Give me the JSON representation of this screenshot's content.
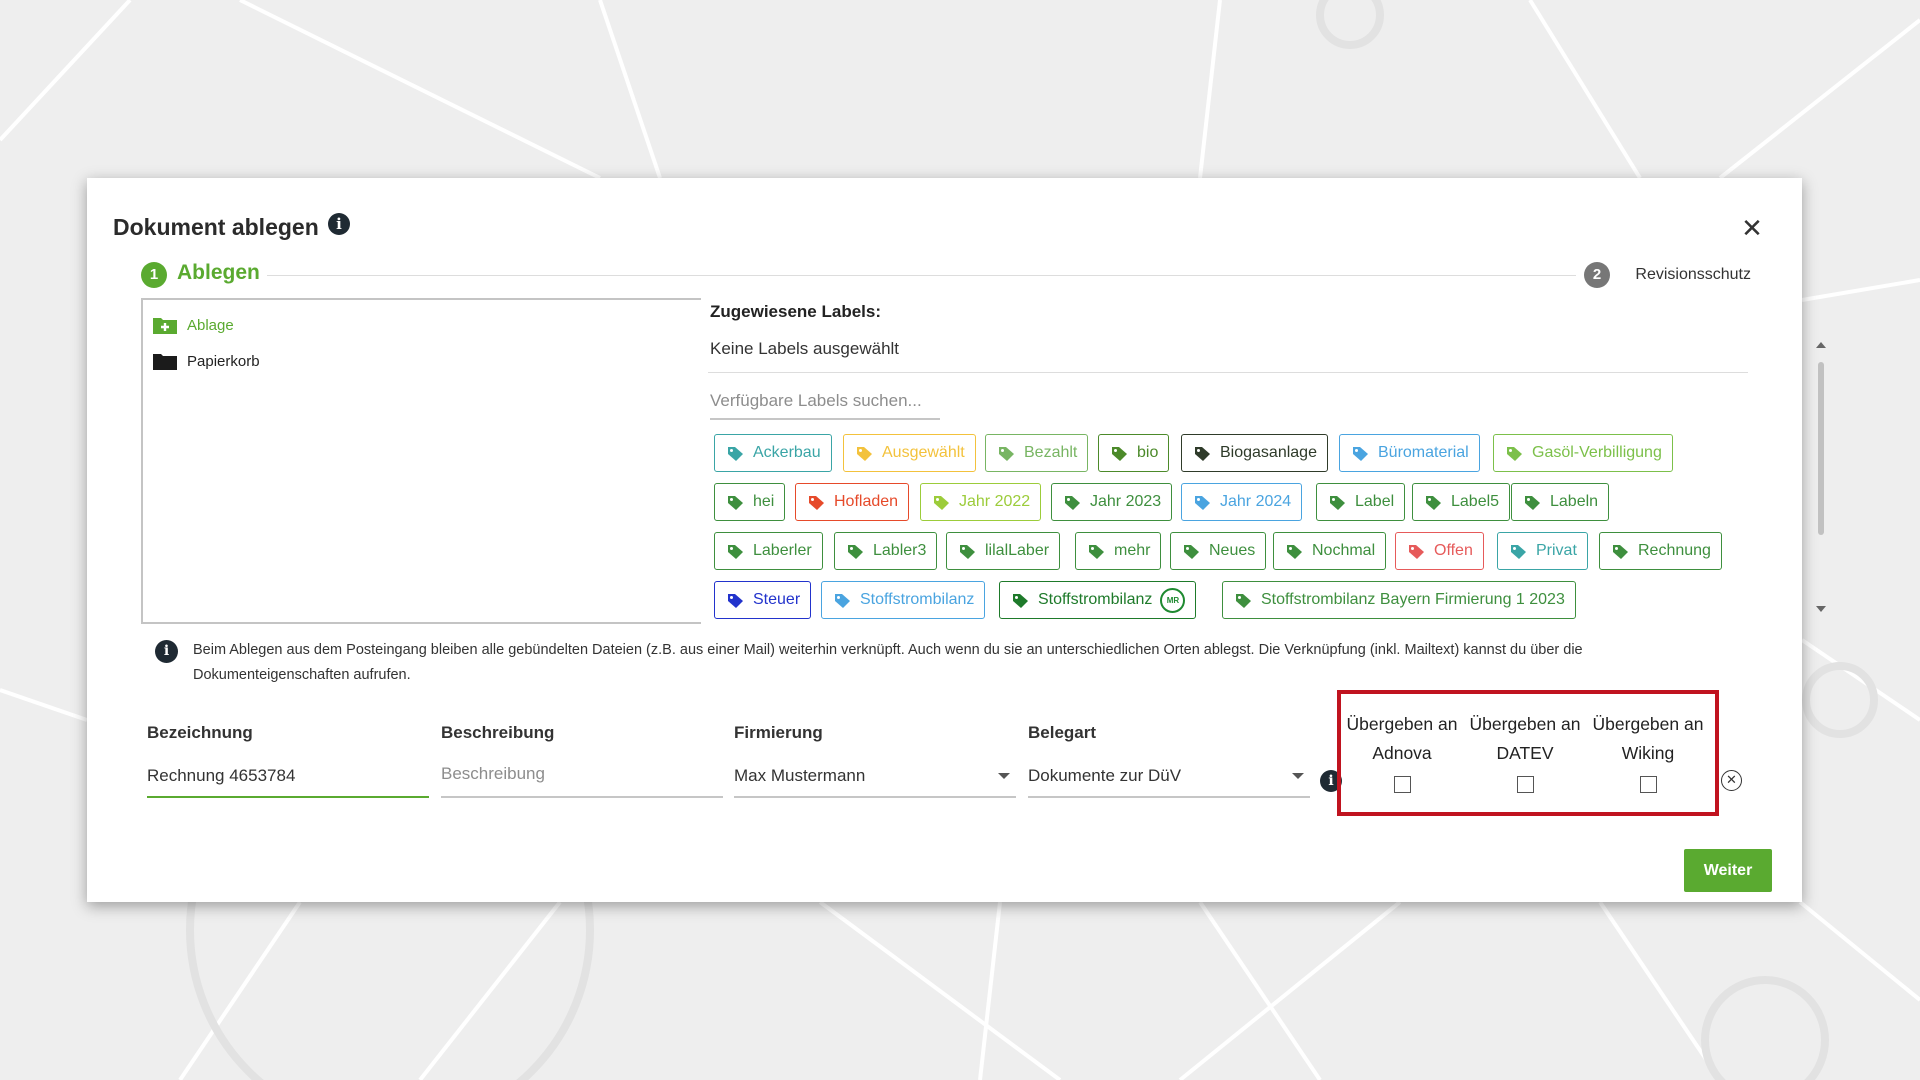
{
  "colors": {
    "accent": "#5aaa30",
    "highlight_box": "#c0131f",
    "info_icon": "#1f2a33"
  },
  "modal": {
    "title": "Dokument ablegen",
    "info_icon": "info-icon",
    "close_icon": "close-icon"
  },
  "stepper": {
    "step1_number": "1",
    "step1_label": "Ablegen",
    "step2_number": "2",
    "step2_label": "Revisionsschutz"
  },
  "folders": [
    {
      "label": "Ablage",
      "icon": "folder-plus-icon"
    },
    {
      "label": "Papierkorb",
      "icon": "folder-icon"
    }
  ],
  "labels": {
    "heading": "Zugewiesene Labels:",
    "selected_text": "Keine Labels ausgewählt",
    "search_placeholder": "Verfügbare Labels suchen...",
    "chips": [
      {
        "text": "Ackerbau",
        "color": "#3aa5a6"
      },
      {
        "text": "Ausgewählt",
        "color": "#f3c23c"
      },
      {
        "text": "Bezahlt",
        "color": "#78b563"
      },
      {
        "text": "bio",
        "color": "#4c8a2a"
      },
      {
        "text": "Biogasanlage",
        "color": "#2f3b2a"
      },
      {
        "text": "Büromaterial",
        "color": "#4aa4e0"
      },
      {
        "text": "Gasöl-Verbilligung",
        "color": "#7cc04a"
      },
      {
        "text": "hei",
        "color": "#3e8f3e"
      },
      {
        "text": "Hofladen",
        "color": "#e64a2a"
      },
      {
        "text": "Jahr 2022",
        "color": "#9ccc3a"
      },
      {
        "text": "Jahr 2023",
        "color": "#3e8f3e"
      },
      {
        "text": "Jahr 2024",
        "color": "#4aa4e0"
      },
      {
        "text": "Label",
        "color": "#3e8f3e"
      },
      {
        "text": "Label5",
        "color": "#3e8f3e"
      },
      {
        "text": "Labeln",
        "color": "#3e8f3e"
      },
      {
        "text": "Laberler",
        "color": "#3e8f3e"
      },
      {
        "text": "Labler3",
        "color": "#3e8f3e"
      },
      {
        "text": "lilalLaber",
        "color": "#3e8f3e"
      },
      {
        "text": "mehr",
        "color": "#3e8f3e"
      },
      {
        "text": "Neues",
        "color": "#3e8f3e"
      },
      {
        "text": "Nochmal",
        "color": "#3e8f3e"
      },
      {
        "text": "Offen",
        "color": "#e65a5a"
      },
      {
        "text": "Privat",
        "color": "#3aa5a6"
      },
      {
        "text": "Rechnung",
        "color": "#3e8f3e"
      },
      {
        "text": "Steuer",
        "color": "#2233cc"
      },
      {
        "text": "Stoffstrombilanz",
        "color": "#4aa4e0"
      },
      {
        "text": "Stoffstrombilanz",
        "color": "#1e7a2a",
        "badge": "MR"
      },
      {
        "text": "Stoffstrombilanz Bayern Firmierung 1 2023",
        "color": "#3e8f3e"
      }
    ]
  },
  "info_text": "Beim Ablegen aus dem Posteingang bleiben alle gebündelten Dateien (z.B. aus einer Mail) weiterhin verknüpft. Auch wenn du sie an unterschiedlichen Orten ablegst. Die Verknüpfung (inkl. Mailtext) kannst du über die Dokumenteigenschaften aufrufen.",
  "form": {
    "bezeichnung": {
      "label": "Bezeichnung",
      "value": "Rechnung 4653784"
    },
    "beschreibung": {
      "label": "Beschreibung",
      "placeholder": "Beschreibung"
    },
    "firmierung": {
      "label": "Firmierung",
      "value": "Max Mustermann"
    },
    "belegart": {
      "label": "Belegart",
      "value": "Dokumente zur DüV"
    }
  },
  "handover": [
    {
      "line1": "Übergeben an",
      "line2": "Adnova",
      "checked": false
    },
    {
      "line1": "Übergeben an",
      "line2": "DATEV",
      "checked": false
    },
    {
      "line1": "Übergeben an",
      "line2": "Wiking",
      "checked": false
    }
  ],
  "weiter_button": "Weiter"
}
